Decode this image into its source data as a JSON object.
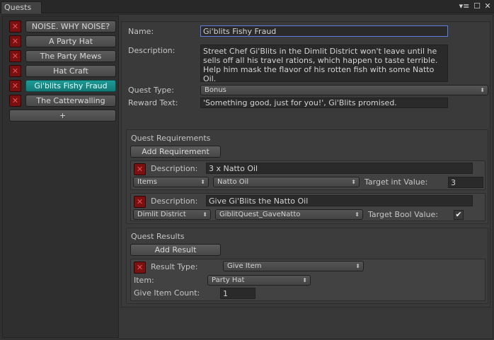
{
  "window": {
    "tab_title": "Quests",
    "controls": {
      "menu": "▾≡",
      "maximize": "☐",
      "close": "✕"
    }
  },
  "sidebar": {
    "delete_glyph": "✕",
    "quests": [
      {
        "label": "NOISE. WHY NOISE?",
        "selected": false
      },
      {
        "label": "A Party Hat",
        "selected": false
      },
      {
        "label": "The Party Mews",
        "selected": false
      },
      {
        "label": "Hat Craft",
        "selected": false
      },
      {
        "label": "Gi'blits Fishy Fraud",
        "selected": true
      },
      {
        "label": "The Catterwalling",
        "selected": false
      }
    ],
    "add_label": "+"
  },
  "quest": {
    "name_label": "Name:",
    "name_value": "Gi'blits Fishy Fraud",
    "description_label": "Description:",
    "description_value": "Street Chef Gi'Blits in the Dimlit District won't leave until he sells off all his travel rations, which happen to taste terrible. Help him mask the flavor of his rotten fish with some Natto Oil.",
    "type_label": "Quest Type:",
    "type_value": "Bonus",
    "reward_label": "Reward Text:",
    "reward_value": "'Something good, just for you!', Gi'Blits promised."
  },
  "requirements": {
    "title": "Quest Requirements",
    "add_button": "Add Requirement",
    "items": [
      {
        "description_label": "Description:",
        "description_value": "3 x Natto Oil",
        "dropdown1": "Items",
        "dropdown2": "Natto Oil",
        "target_label": "Target int Value:",
        "target_value": "3"
      },
      {
        "description_label": "Description:",
        "description_value": "Give Gi'Blits the Natto Oil",
        "dropdown1": "Dimlit District",
        "dropdown2": "GiblitQuest_GaveNatto",
        "target_label": "Target Bool Value:",
        "target_checked": "✔"
      }
    ]
  },
  "results": {
    "title": "Quest Results",
    "add_button": "Add Result",
    "items": [
      {
        "type_label": "Result Type:",
        "type_value": "Give Item",
        "item_label": "Item:",
        "item_value": "Party Hat",
        "count_label": "Give Item Count:",
        "count_value": "1"
      }
    ]
  },
  "colors": {
    "selected_accent": "#1a8a86",
    "delete_red": "#7a1010",
    "focus_border": "#5c7ddc",
    "background": "#383838"
  }
}
